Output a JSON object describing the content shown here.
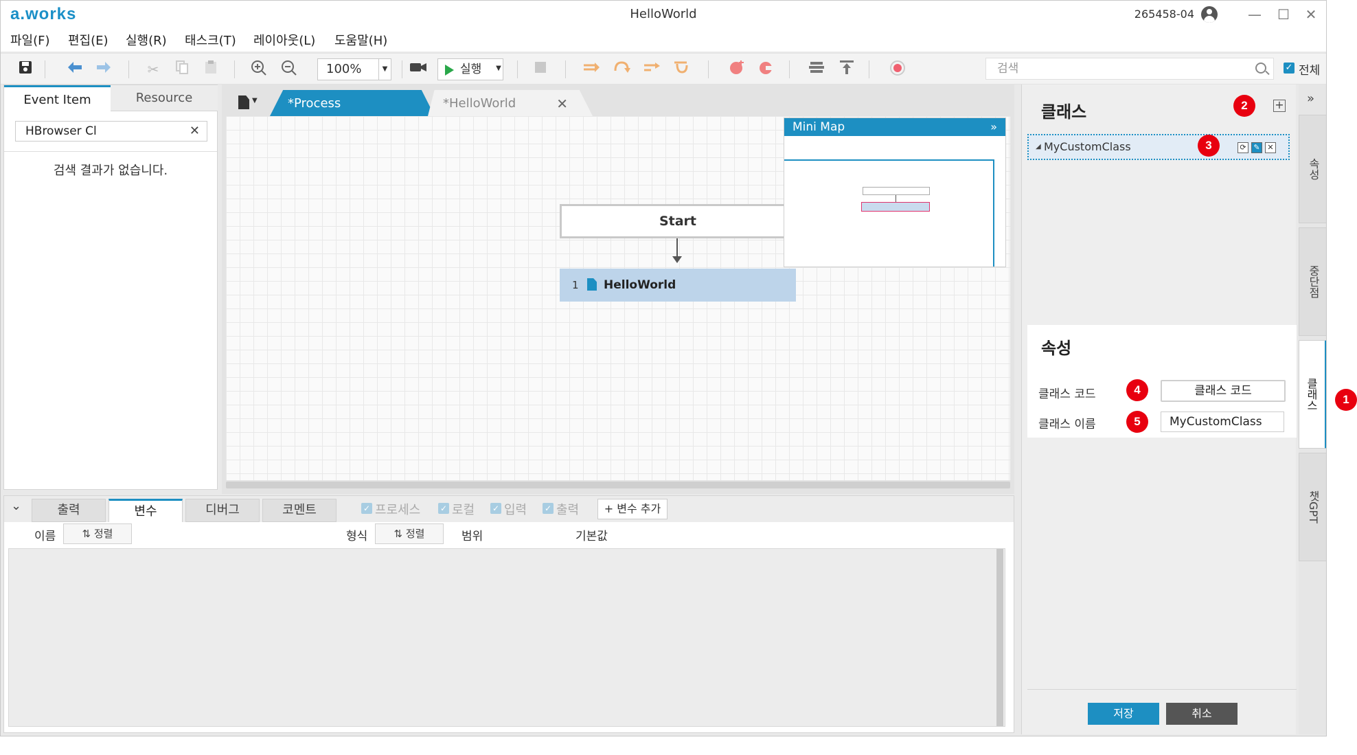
{
  "app": {
    "logo": "a.works",
    "title": "HelloWorld",
    "user_id": "265458-04",
    "window_controls": {
      "minimize": "—",
      "maximize": "☐",
      "close": "✕"
    }
  },
  "menu": [
    "파일(F)",
    "편집(E)",
    "실행(R)",
    "태스크(T)",
    "레이아웃(L)",
    "도움말(H)"
  ],
  "toolbar": {
    "zoom": "100%",
    "run_label": "실행",
    "search_placeholder": "검색",
    "all_label": "전체",
    "icons": [
      "save-icon",
      "back-icon",
      "forward-icon",
      "cut-icon",
      "copy-icon",
      "paste-icon",
      "zoom-in-icon",
      "zoom-out-icon",
      "camera-icon",
      "stop-icon",
      "step-icon",
      "step-over-icon",
      "step-into-icon",
      "step-out-icon",
      "breakpoint-icon",
      "clear-breakpoint-icon",
      "align-icon",
      "align-top-icon",
      "record-icon"
    ]
  },
  "left_panel": {
    "tabs": [
      "Event Item",
      "Resource"
    ],
    "search_value": "HBrowser Cl",
    "empty_message": "검색 결과가 없습니다."
  },
  "editor": {
    "tabs": [
      "*Process",
      "*HelloWorld"
    ],
    "nodes": {
      "start": "Start",
      "step_number": "1",
      "step_label": "HelloWorld"
    },
    "minimap_title": "Mini Map"
  },
  "bottom_panel": {
    "tabs": [
      "출력",
      "변수",
      "디버그",
      "코멘트"
    ],
    "filters": [
      "프로세스",
      "로컬",
      "입력",
      "출력"
    ],
    "add_variable": "+ 변수 추가",
    "columns": {
      "name": "이름",
      "type": "형식",
      "scope": "범위",
      "default": "기본값"
    },
    "sort_label": "⇅ 정렬"
  },
  "right_panel": {
    "class_section_title": "클래스",
    "class_item": "MyCustomClass",
    "properties_title": "속성",
    "class_code_label": "클래스 코드",
    "class_code_button": "클래스 코드",
    "class_name_label": "클래스 이름",
    "class_name_value": "MyCustomClass",
    "save": "저장",
    "cancel": "취소"
  },
  "side_tabs": [
    "속성",
    "중단점",
    "클래스",
    "챗GPT"
  ],
  "markers": [
    "1",
    "2",
    "3",
    "4",
    "5"
  ],
  "colors": {
    "accent": "#1d8fc2",
    "marker": "#e8000f",
    "node_selected": "#bdd4ea"
  }
}
